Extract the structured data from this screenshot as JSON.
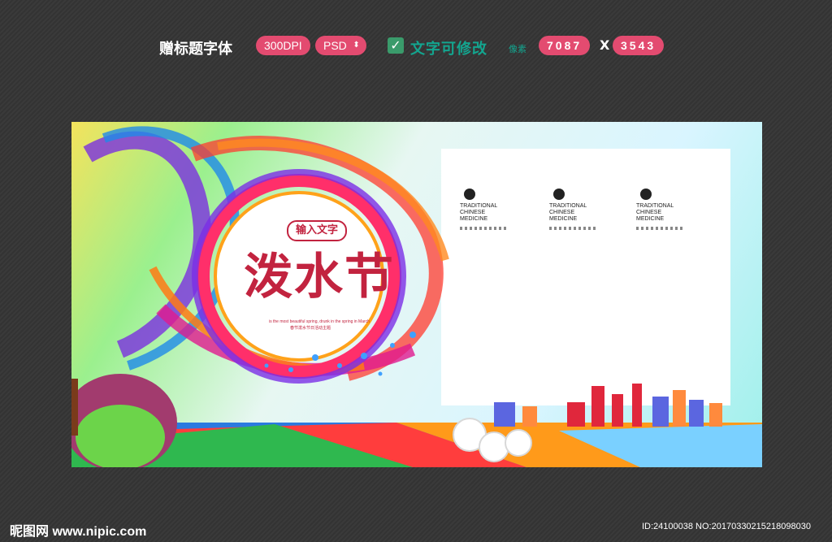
{
  "toolbar": {
    "title": "赠标题字体",
    "dpi": "300DPI",
    "format": "PSD",
    "checkbox_label": "文字可修改",
    "size_label": "像素",
    "width": "7087",
    "times": "X",
    "height": "3543"
  },
  "poster": {
    "badge": "输入文字",
    "title": "泼水节",
    "subtitle_en": "is the most beautiful spring, drunk in the spring in March",
    "subtitle_cn": "春节泼水节日活动主题",
    "logos": [
      {
        "text1": "TRADITIONAL",
        "text2": "CHINESE",
        "text3": "MEDICINE"
      },
      {
        "text1": "TRADITIONAL",
        "text2": "CHINESE",
        "text3": "MEDICINE"
      },
      {
        "text1": "TRADITIONAL",
        "text2": "CHINESE",
        "text3": "MEDICINE"
      }
    ]
  },
  "watermark": {
    "site": "昵图网 www.nipic.com",
    "id": "ID:24100038 NO:20170330215218098030"
  },
  "colors": {
    "accent": "#e34b70",
    "teal": "#13a58f",
    "title_red": "#c2233f"
  }
}
